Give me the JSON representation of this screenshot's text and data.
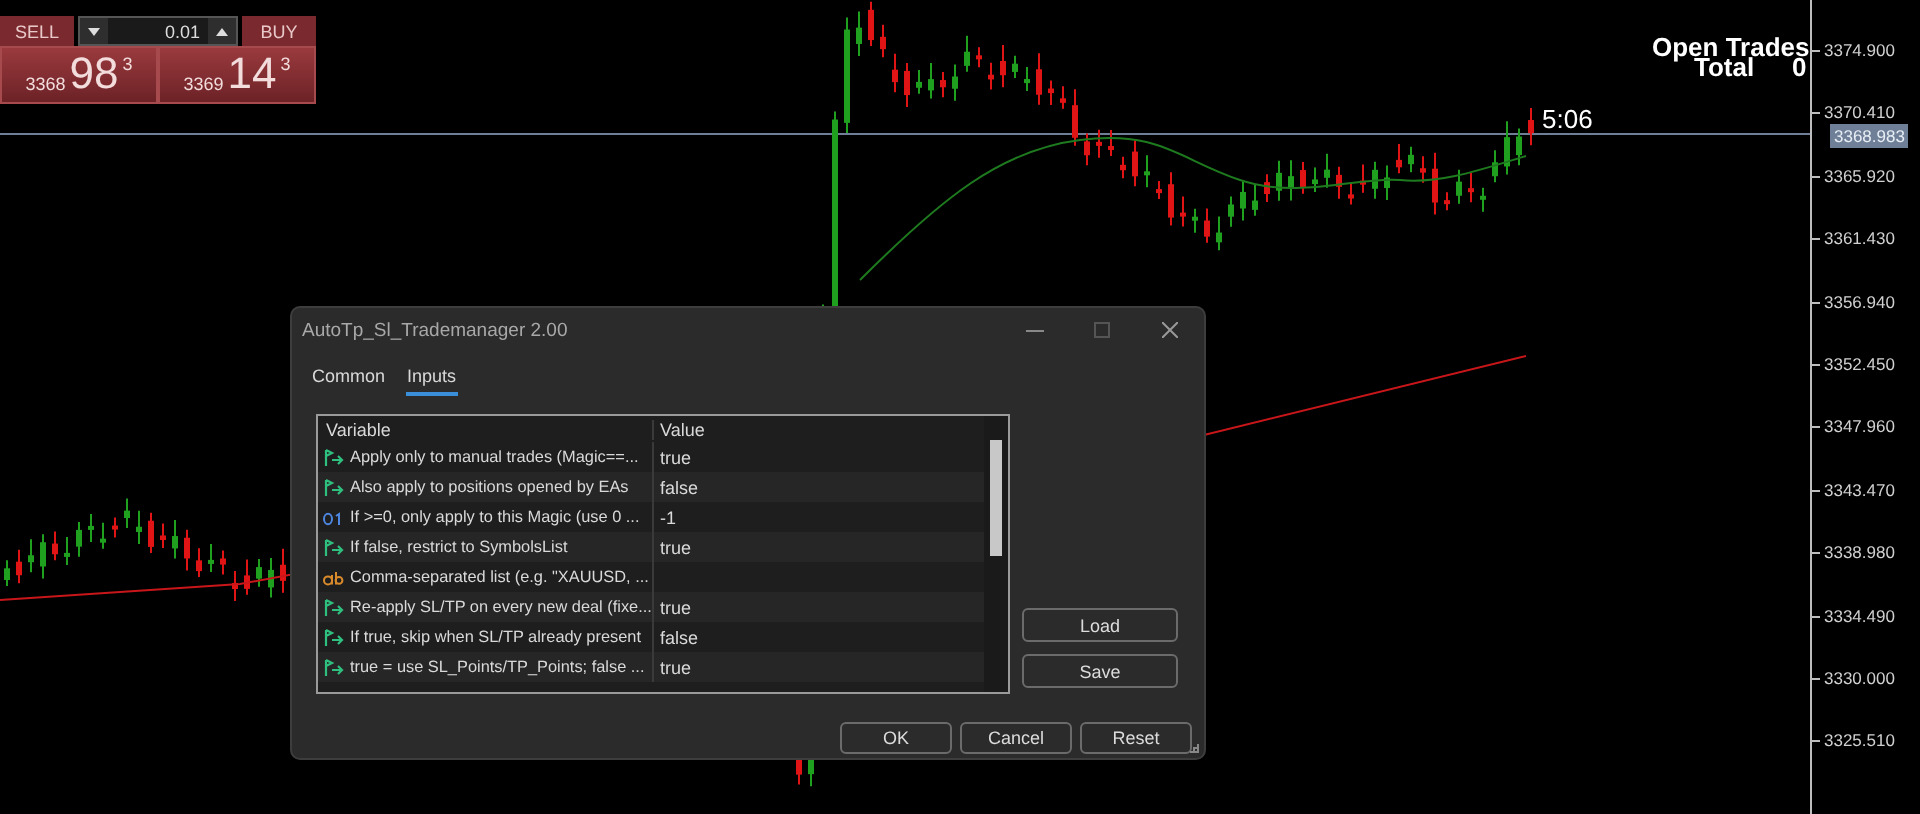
{
  "trade_panel": {
    "sell_label": "SELL",
    "buy_label": "BUY",
    "lot": "0.01",
    "bid": {
      "big": "3368",
      "main": "98",
      "small": "3"
    },
    "ask": {
      "big": "3369",
      "main": "14",
      "small": "3"
    }
  },
  "overlay": {
    "title": "Open Trades",
    "total_label": "Total",
    "total_value": "0",
    "timer": "5:06"
  },
  "price_axis": {
    "ticks": [
      "3374.900",
      "3370.410",
      "3365.920",
      "3361.430",
      "3356.940",
      "3352.450",
      "3347.960",
      "3343.470",
      "3338.980",
      "3334.490",
      "3330.000",
      "3325.510"
    ],
    "current": "3368.983"
  },
  "dialog": {
    "title": "AutoTp_Sl_Trademanager 2.00",
    "tabs": [
      {
        "label": "Common",
        "selected": false
      },
      {
        "label": "Inputs",
        "selected": true
      }
    ],
    "columns": [
      "Variable",
      "Value"
    ],
    "rows": [
      {
        "kind": "bool",
        "variable": "Apply only to manual trades (Magic==...",
        "value": "true"
      },
      {
        "kind": "bool",
        "variable": "Also apply to positions opened by EAs",
        "value": "false"
      },
      {
        "kind": "int",
        "variable": "If >=0, only apply to this Magic (use 0 ...",
        "value": "-1"
      },
      {
        "kind": "bool",
        "variable": "If false, restrict to SymbolsList",
        "value": "true"
      },
      {
        "kind": "string",
        "variable": "Comma-separated list (e.g. \"XAUUSD, ...",
        "value": ""
      },
      {
        "kind": "bool",
        "variable": "Re-apply SL/TP on every new deal (fixe...",
        "value": "true"
      },
      {
        "kind": "bool",
        "variable": "If true, skip when SL/TP already present",
        "value": "false"
      },
      {
        "kind": "bool",
        "variable": "true = use SL_Points/TP_Points; false ...",
        "value": "true"
      }
    ],
    "side_buttons": [
      "Load",
      "Save"
    ],
    "buttons": [
      "OK",
      "Cancel",
      "Reset"
    ]
  }
}
